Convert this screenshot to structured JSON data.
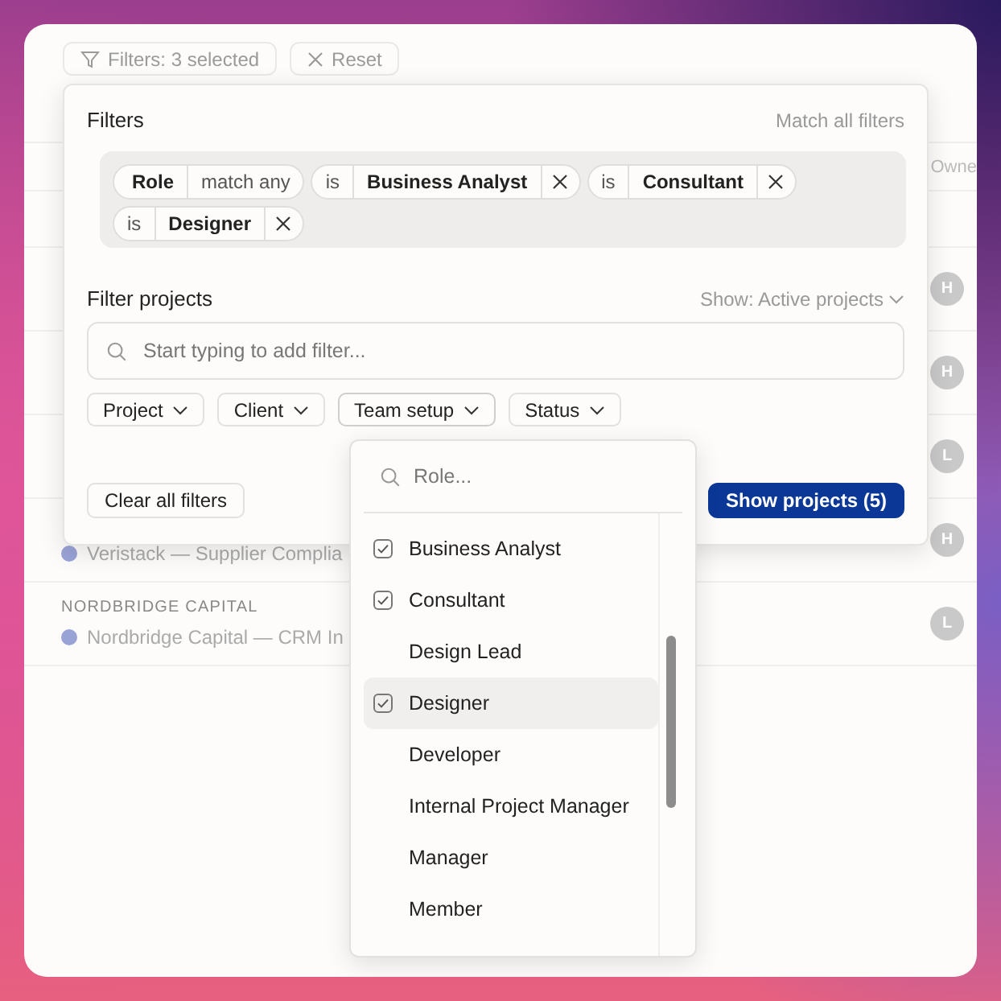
{
  "toolbar": {
    "filters_button": "Filters: 3 selected",
    "reset_button": "Reset"
  },
  "table": {
    "owner_header": "Owne",
    "rows": [
      {
        "kind": "empty",
        "owner": "H"
      },
      {
        "kind": "empty",
        "owner": "H"
      },
      {
        "kind": "empty",
        "owner": "L"
      },
      {
        "kind": "project",
        "project": "Veristack — Supplier Complia",
        "color": "#9aa3d6",
        "owner": "H"
      },
      {
        "kind": "project",
        "group": "NORDBRIDGE CAPITAL",
        "project": "Nordbridge Capital — CRM In",
        "color": "#9aa3d6",
        "owner": "L"
      }
    ]
  },
  "filter_panel": {
    "title": "Filters",
    "match_mode": "Match all filters",
    "rule": {
      "field": "Role",
      "mode": "match any",
      "values": [
        {
          "operator": "is",
          "value": "Business Analyst"
        },
        {
          "operator": "is",
          "value": "Consultant"
        },
        {
          "operator": "is",
          "value": "Designer"
        }
      ]
    },
    "section_title": "Filter projects",
    "show_select": "Show: Active projects",
    "search": {
      "placeholder": "Start typing to add filter..."
    },
    "dropdowns": [
      {
        "label": "Project",
        "expanded": false
      },
      {
        "label": "Client",
        "expanded": false
      },
      {
        "label": "Team setup",
        "expanded": true
      },
      {
        "label": "Status",
        "expanded": false
      }
    ],
    "clear_button": "Clear all filters",
    "apply_button": "Show projects (5)"
  },
  "role_menu": {
    "search": {
      "placeholder": "Role..."
    },
    "options": [
      {
        "label": "Business Analyst",
        "checked": true,
        "highlighted": false
      },
      {
        "label": "Consultant",
        "checked": true,
        "highlighted": false
      },
      {
        "label": "Design Lead",
        "checked": false,
        "highlighted": false
      },
      {
        "label": "Designer",
        "checked": true,
        "highlighted": true
      },
      {
        "label": "Developer",
        "checked": false,
        "highlighted": false
      },
      {
        "label": "Internal Project Manager",
        "checked": false,
        "highlighted": false
      },
      {
        "label": "Manager",
        "checked": false,
        "highlighted": false
      },
      {
        "label": "Member",
        "checked": false,
        "highlighted": false
      }
    ]
  }
}
